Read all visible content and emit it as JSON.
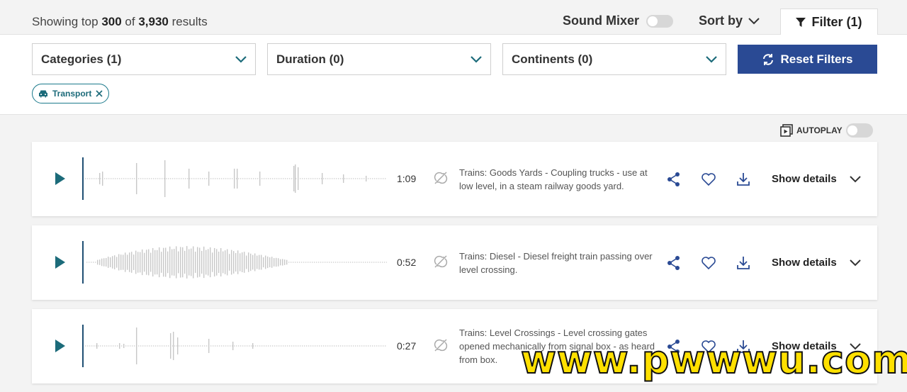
{
  "header": {
    "results_prefix": "Showing top",
    "results_shown": "300",
    "results_of": "of",
    "results_total": "3,930",
    "results_suffix": "results",
    "sound_mixer_label": "Sound Mixer",
    "sort_label": "Sort by",
    "filter_label": "Filter (1)"
  },
  "filters": {
    "dropdowns": [
      {
        "label": "Categories (1)"
      },
      {
        "label": "Duration (0)"
      },
      {
        "label": "Continents (0)"
      }
    ],
    "reset_label": "Reset Filters",
    "chips": [
      {
        "label": "Transport",
        "icon": "car-icon"
      }
    ]
  },
  "autoplay": {
    "label": "AUTOPLAY",
    "enabled": false
  },
  "tracks": [
    {
      "duration": "1:09",
      "description": "Trains: Goods Yards - Coupling trucks - use at low level, in a steam railway goods yard.",
      "details_label": "Show details"
    },
    {
      "duration": "0:52",
      "description": "Trains: Diesel - Diesel freight train passing over level crossing.",
      "details_label": "Show details"
    },
    {
      "duration": "0:27",
      "description": "Trains: Level Crossings - Level crossing gates opened mechanically from signal box - as heard from box.",
      "details_label": "Show details"
    }
  ],
  "colors": {
    "accent": "#2a4a94",
    "teal": "#1c6b7a",
    "waveform": "#c8c8c8",
    "playhead": "#1f4f74"
  },
  "watermark": "www.pwwwu.com"
}
